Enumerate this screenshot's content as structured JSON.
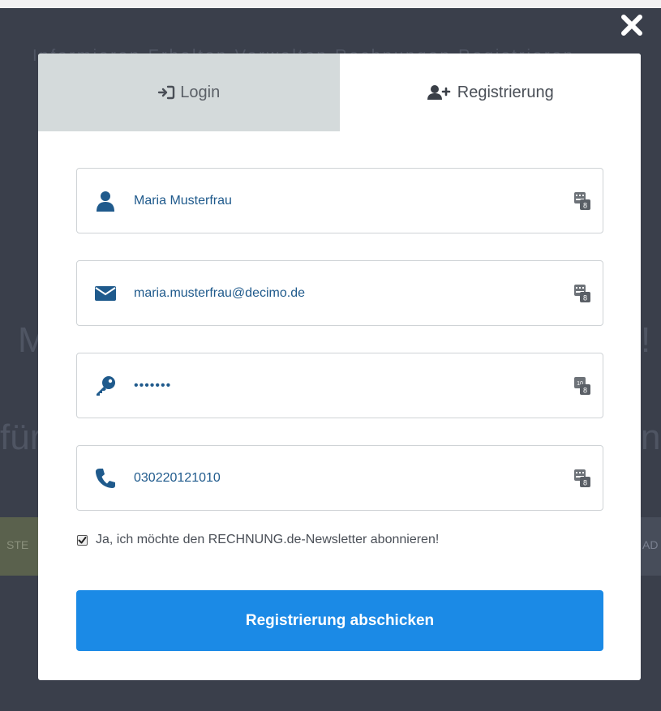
{
  "background": {
    "row1": "Informieren    Erhalten    Verwalten    Rechnungen    Registrieren",
    "big_left": "M",
    "big_right": "!",
    "fur": "für",
    "n": "n",
    "band_left": "STE",
    "band_right": "AD"
  },
  "tabs": {
    "login_label": "Login",
    "register_label": "Registrierung"
  },
  "form": {
    "name_value": "Maria Musterfrau",
    "email_value": "maria.musterfrau@decimo.de",
    "password_value": "•••••••",
    "phone_value": "030220121010"
  },
  "newsletter": {
    "checked": true,
    "label": "Ja, ich möchte den RECHNUNG.de-Newsletter abonnieren!"
  },
  "submit_label": "Registrierung abschicken",
  "colors": {
    "accent": "#1b8ae6",
    "icon": "#1f5a8c",
    "tab_inactive": "#d4dadb"
  }
}
